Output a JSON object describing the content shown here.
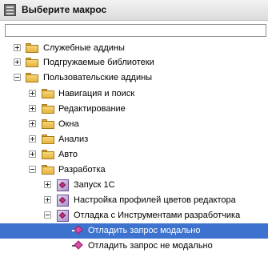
{
  "window": {
    "title": "Выберите макрос",
    "icon": "macro-list-icon"
  },
  "search": {
    "value": "",
    "placeholder": ""
  },
  "tree": {
    "items": [
      {
        "label": "Служебные аддины",
        "icon": "folder-icon",
        "expanded": false,
        "selected": false
      },
      {
        "label": "Подгружаемые библиотеки",
        "icon": "folder-icon",
        "expanded": false,
        "selected": false
      },
      {
        "label": "Пользовательские аддины",
        "icon": "folder-icon",
        "expanded": true,
        "selected": false
      },
      {
        "label": "Навигация и поиск",
        "icon": "folder-icon",
        "expanded": false,
        "selected": false
      },
      {
        "label": "Редактирование",
        "icon": "folder-icon",
        "expanded": false,
        "selected": false
      },
      {
        "label": "Окна",
        "icon": "folder-icon",
        "expanded": false,
        "selected": false
      },
      {
        "label": "Анализ",
        "icon": "folder-icon",
        "expanded": false,
        "selected": false
      },
      {
        "label": "Авто",
        "icon": "folder-icon",
        "expanded": false,
        "selected": false
      },
      {
        "label": "Разработка",
        "icon": "folder-icon",
        "expanded": true,
        "selected": false
      },
      {
        "label": "Запуск 1С",
        "icon": "addin-icon",
        "expanded": false,
        "selected": false
      },
      {
        "label": "Настройка профилей цветов редактора",
        "icon": "addin-icon",
        "expanded": false,
        "selected": false
      },
      {
        "label": "Отладка с Инструментами разработчика",
        "icon": "addin-icon",
        "expanded": true,
        "selected": false
      },
      {
        "label": "Отладить запрос модально",
        "icon": "macro-method-icon",
        "expanded": null,
        "selected": true
      },
      {
        "label": "Отладить запрос не модально",
        "icon": "macro-method-icon",
        "expanded": null,
        "selected": false
      }
    ]
  },
  "colors": {
    "selection": "#3d73ce",
    "folder": "#e7b441",
    "addin": "#a891c9",
    "macro_gem": "#d94ca6"
  }
}
